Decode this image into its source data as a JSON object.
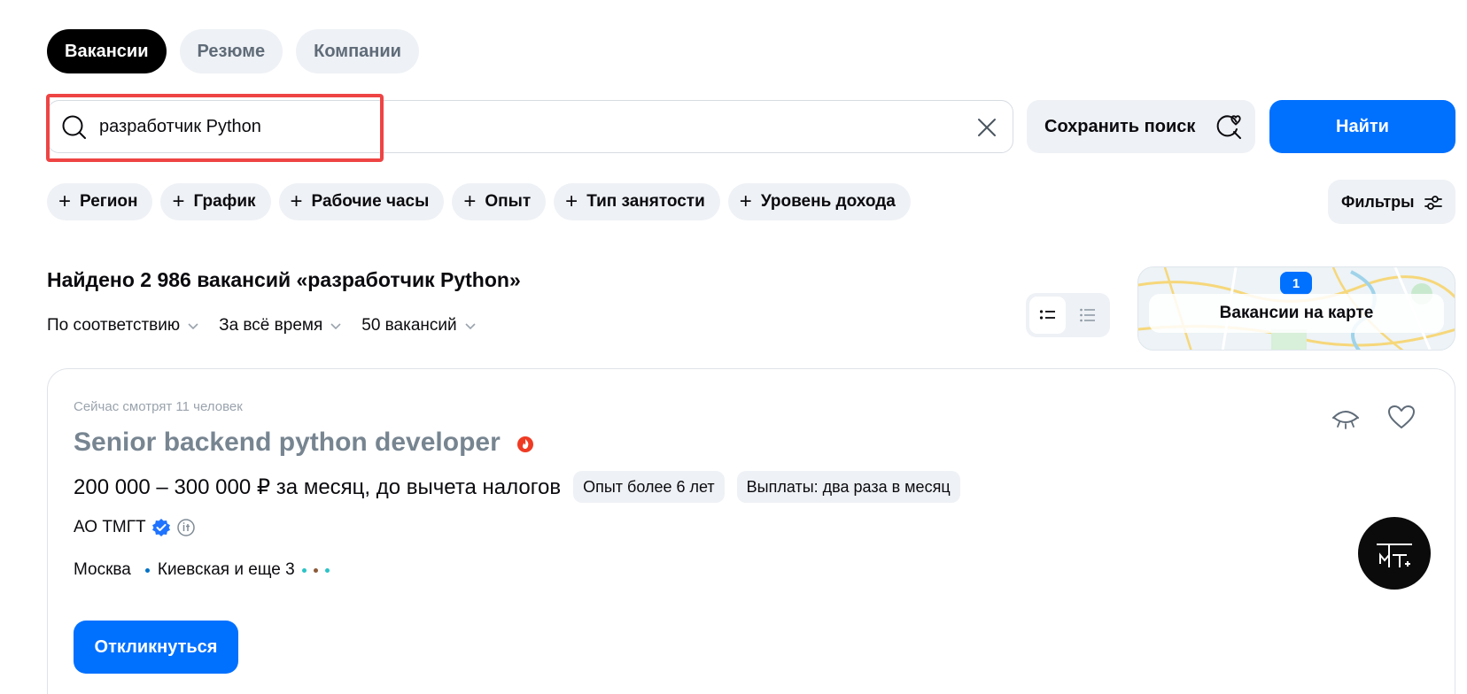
{
  "tabs": [
    "Вакансии",
    "Резюме",
    "Компании"
  ],
  "search": {
    "value": "разработчик Python",
    "save_label": "Сохранить поиск",
    "find_label": "Найти"
  },
  "filter_chips": [
    "Регион",
    "График",
    "Рабочие часы",
    "Опыт",
    "Тип занятости",
    "Уровень дохода"
  ],
  "filters_label": "Фильтры",
  "results": {
    "title": "Найдено 2 986 вакансий «разработчик Python»",
    "sort": "По соответствию",
    "period": "За всё время",
    "per_page": "50 вакансий"
  },
  "map": {
    "label": "Вакансии на карте",
    "pin_count": "1"
  },
  "vacancy": {
    "watching": "Сейчас смотрят 11 человек",
    "title": "Senior backend python developer",
    "salary": "200 000 – 300 000 ₽ за месяц, до вычета налогов",
    "tags": [
      "Опыт более 6 лет",
      "Выплаты: два раза в месяц"
    ],
    "company": "АО ТМГТ",
    "city": "Москва",
    "metro": "Киевская и еще 3",
    "apply_label": "Откликнуться"
  },
  "colors": {
    "accent": "#0070ff",
    "highlight": "#ef4444",
    "chip_bg": "#eef1f5",
    "title_gray": "#778591",
    "metro_dots": [
      "#0072c6",
      "#2bc3c6",
      "#8c5a38",
      "#2bc3c6"
    ]
  }
}
